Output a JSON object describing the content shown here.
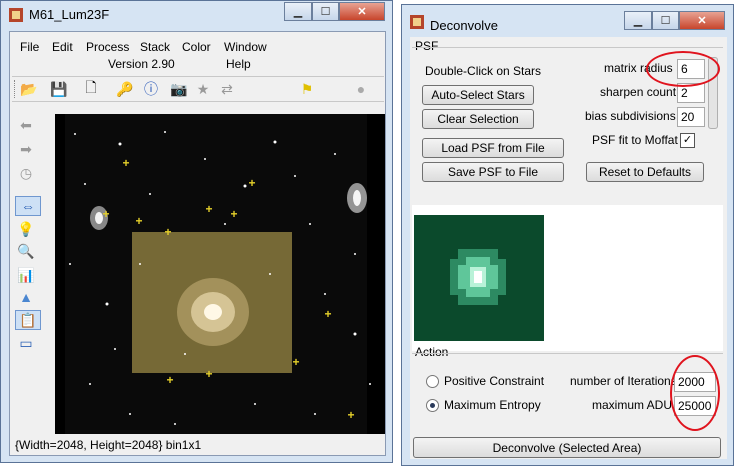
{
  "left_window": {
    "title": "M61_Lum23F",
    "menu": [
      "File",
      "Edit",
      "Process",
      "Stack",
      "Color",
      "Window"
    ],
    "version": "Version 2.90",
    "help": "Help",
    "status": "{Width=2048, Height=2048} bin1x1"
  },
  "right_window": {
    "title": "Deconvolve",
    "psf_group": "PSF",
    "double_click_label": "Double-Click on Stars",
    "auto_select": "Auto-Select Stars",
    "clear_selection": "Clear Selection",
    "load_psf": "Load PSF from File",
    "save_psf": "Save PSF to File",
    "reset_defaults": "Reset to Defaults",
    "matrix_radius_label": "matrix radius",
    "matrix_radius_value": "6",
    "sharpen_count_label": "sharpen count",
    "sharpen_count_value": "2",
    "bias_label": "bias subdivisions",
    "bias_value": "20",
    "psf_fit_label": "PSF fit to Moffat",
    "action_group": "Action",
    "positive_constraint": "Positive Constraint",
    "maximum_entropy": "Maximum Entropy",
    "iterations_label": "number of Iterations",
    "iterations_value": "2000",
    "max_adu_label": "maximum ADU",
    "max_adu_value": "25000",
    "deconvolve_button": "Deconvolve (Selected Area)"
  },
  "icons": {
    "app": "app-icon",
    "minimize": "minimize-icon",
    "maximize": "maximize-icon",
    "close": "close-icon"
  },
  "colors": {
    "selection": "#8a7a3e",
    "star_marker": "#e5d02a",
    "annotation": "#e0141e",
    "psf_bg": "#0b4a2c"
  }
}
